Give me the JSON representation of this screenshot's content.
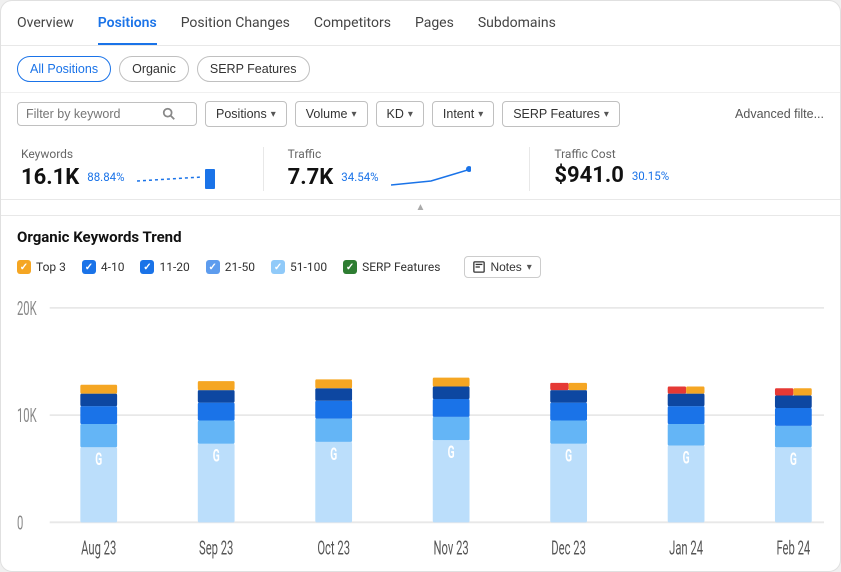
{
  "nav": {
    "tabs": [
      {
        "label": "Overview",
        "active": false
      },
      {
        "label": "Positions",
        "active": true
      },
      {
        "label": "Position Changes",
        "active": false
      },
      {
        "label": "Competitors",
        "active": false
      },
      {
        "label": "Pages",
        "active": false
      },
      {
        "label": "Subdomains",
        "active": false
      }
    ]
  },
  "filter_pills": {
    "items": [
      {
        "label": "All Positions",
        "active": true
      },
      {
        "label": "Organic",
        "active": false
      },
      {
        "label": "SERP Features",
        "active": false
      }
    ]
  },
  "search": {
    "placeholder": "Filter by keyword"
  },
  "dropdowns": [
    {
      "label": "Positions"
    },
    {
      "label": "Volume"
    },
    {
      "label": "KD"
    },
    {
      "label": "Intent"
    },
    {
      "label": "SERP Features"
    }
  ],
  "advanced_label": "Advanced filte...",
  "metrics": [
    {
      "label": "Keywords",
      "value": "16.1K",
      "change": "88.84%",
      "sparkline_type": "bar"
    },
    {
      "label": "Traffic",
      "value": "7.7K",
      "change": "34.54%",
      "sparkline_type": "line"
    },
    {
      "label": "Traffic Cost",
      "value": "$941.0",
      "change": "30.15%",
      "sparkline_type": "none"
    }
  ],
  "trend": {
    "title": "Organic Keywords Trend",
    "legend": [
      {
        "label": "Top 3",
        "color": "#f5a623",
        "checked": true
      },
      {
        "label": "4-10",
        "color": "#1a73e8",
        "checked": true
      },
      {
        "label": "11-20",
        "color": "#1a73e8",
        "checked": true
      },
      {
        "label": "21-50",
        "color": "#1a73e8",
        "checked": true
      },
      {
        "label": "51-100",
        "color": "#1a73e8",
        "checked": true
      },
      {
        "label": "SERP Features",
        "color": "#2e7d32",
        "checked": true
      }
    ],
    "notes_label": "Notes",
    "y_labels": [
      "20K",
      "10K",
      "0"
    ],
    "x_labels": [
      "Aug 23",
      "Sep 23",
      "Oct 23",
      "Nov 23",
      "Dec 23",
      "Jan 24",
      "Feb 24"
    ]
  }
}
